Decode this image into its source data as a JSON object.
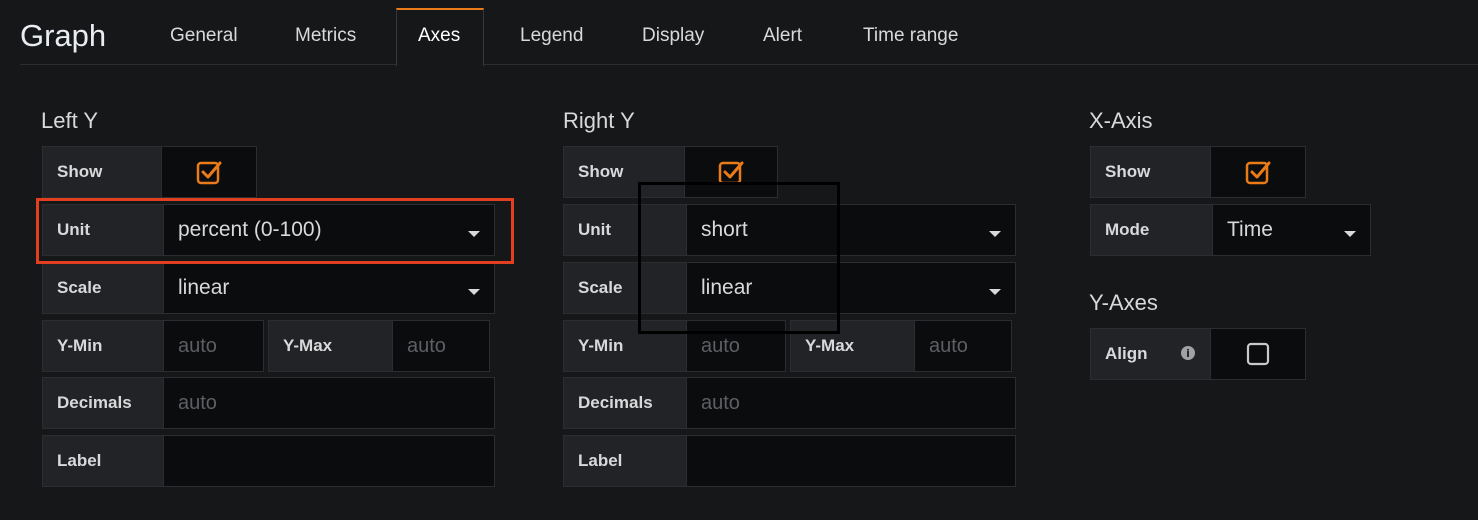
{
  "header": {
    "title": "Graph",
    "tabs": [
      {
        "label": "General"
      },
      {
        "label": "Metrics"
      },
      {
        "label": "Axes"
      },
      {
        "label": "Legend"
      },
      {
        "label": "Display"
      },
      {
        "label": "Alert"
      },
      {
        "label": "Time range"
      }
    ],
    "active_tab": "Axes"
  },
  "left_y": {
    "title": "Left Y",
    "show_label": "Show",
    "show_checked": true,
    "unit_label": "Unit",
    "unit_value": "percent (0-100)",
    "scale_label": "Scale",
    "scale_value": "linear",
    "ymin_label": "Y-Min",
    "ymin_placeholder": "auto",
    "ymax_label": "Y-Max",
    "ymax_placeholder": "auto",
    "decimals_label": "Decimals",
    "decimals_placeholder": "auto",
    "label_label": "Label",
    "label_value": ""
  },
  "right_y": {
    "title": "Right Y",
    "show_label": "Show",
    "show_checked": true,
    "unit_label": "Unit",
    "unit_value": "short",
    "scale_label": "Scale",
    "scale_value": "linear",
    "ymin_label": "Y-Min",
    "ymin_placeholder": "auto",
    "ymax_label": "Y-Max",
    "ymax_placeholder": "auto",
    "decimals_label": "Decimals",
    "decimals_placeholder": "auto",
    "label_label": "Label",
    "label_value": ""
  },
  "x_axis": {
    "title": "X-Axis",
    "show_label": "Show",
    "show_checked": true,
    "mode_label": "Mode",
    "mode_value": "Time"
  },
  "y_axes": {
    "title": "Y-Axes",
    "align_label": "Align",
    "align_checked": false
  },
  "colors": {
    "accent": "#eb7b18",
    "highlight_red": "#e23e20"
  }
}
